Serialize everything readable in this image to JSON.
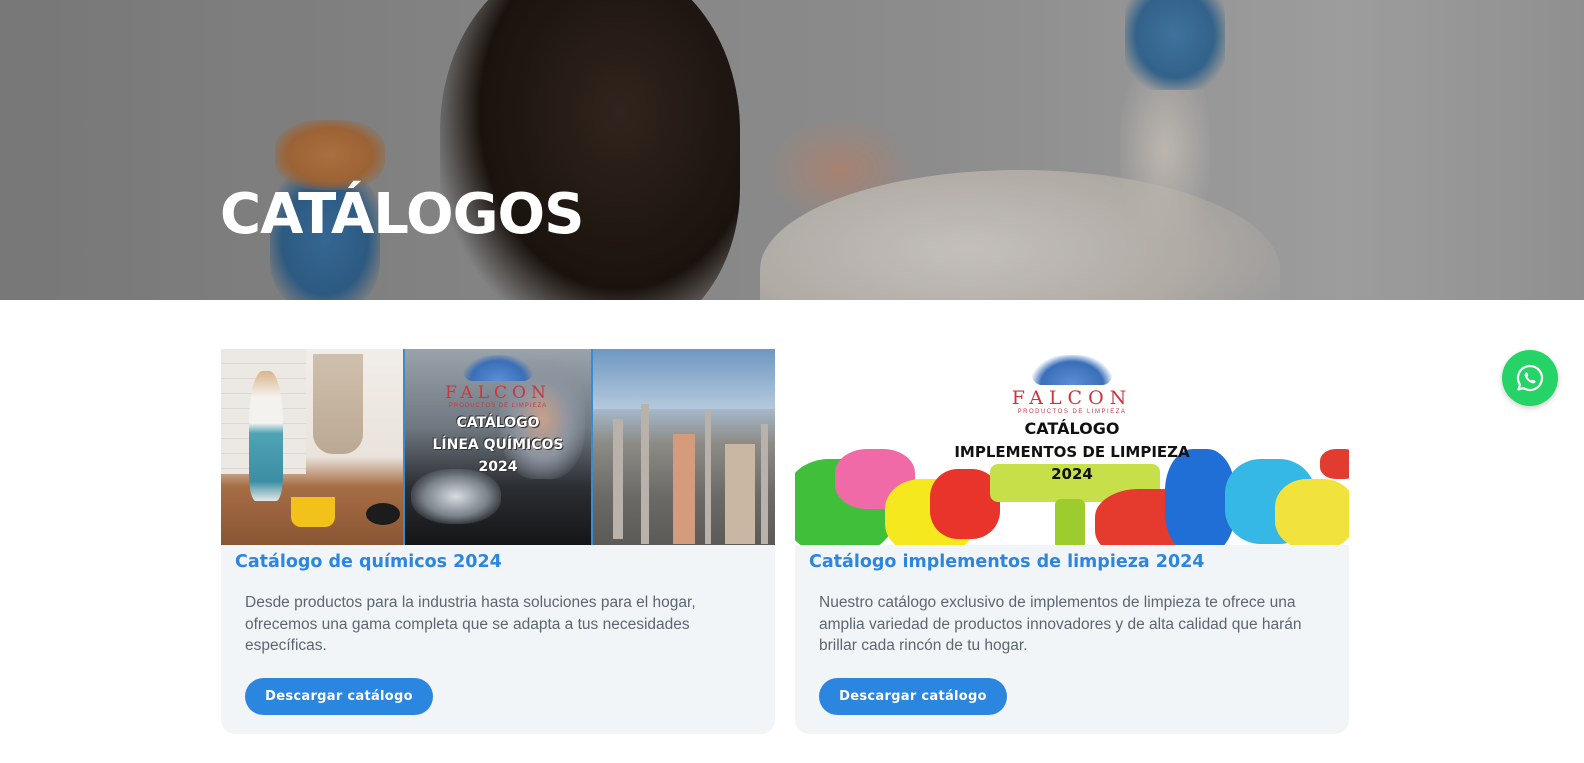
{
  "hero": {
    "title": "CATÁLOGOS"
  },
  "cards": [
    {
      "title": "Catálogo de químicos 2024",
      "description": "Desde productos para la industria hasta soluciones para el hogar, ofrecemos una gama completa que se adapta a tus necesidades específicas.",
      "button_label": "Descargar catálogo",
      "image": {
        "brand": "FALCON",
        "brand_sub": "PRODUCTOS DE LIMPIEZA",
        "line1": "CATÁLOGO",
        "line2": "LÍNEA QUÍMICOS",
        "line3": "2024"
      }
    },
    {
      "title": "Catálogo implementos de limpieza 2024",
      "description": "Nuestro catálogo exclusivo de implementos de limpieza te ofrece una amplia variedad de productos innovadores y de alta calidad que harán brillar cada rincón de tu hogar.",
      "button_label": "Descargar catálogo",
      "image": {
        "brand": "FALCON",
        "brand_sub": "PRODUCTOS DE LIMPIEZA",
        "line1": "CATÁLOGO",
        "line2": "IMPLEMENTOS DE LIMPIEZA",
        "line3": "2024"
      }
    }
  ],
  "whatsapp": {
    "icon": "whatsapp-icon",
    "color": "#25d366"
  },
  "colors": {
    "accent": "#2b86e0",
    "card_background": "#f2f5f7",
    "body_text": "#5c6670"
  }
}
